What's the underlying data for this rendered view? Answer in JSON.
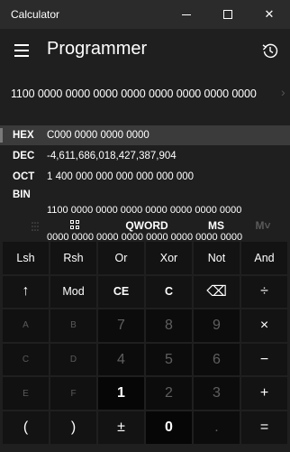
{
  "window": {
    "title": "Calculator",
    "minimize_icon": "minimize-icon",
    "maximize_icon": "maximize-icon",
    "close_icon": "close-icon",
    "close_glyph": "✕"
  },
  "header": {
    "menu_icon": "hamburger-menu-icon",
    "mode_title": "Programmer",
    "history_icon": "history-icon"
  },
  "display": {
    "binary_value": "1100 0000 0000 0000 0000 0000 0000 0000 0000",
    "chevron": "›"
  },
  "radix": {
    "hex": {
      "label": "HEX",
      "value": "C000 0000 0000 0000"
    },
    "dec": {
      "label": "DEC",
      "value": "-4,611,686,018,427,387,904"
    },
    "oct": {
      "label": "OCT",
      "value": "1 400 000 000 000 000 000 000"
    },
    "bin": {
      "label": "BIN",
      "value_line1": "1100 0000 0000 0000 0000 0000 0000 0000",
      "value_line2": "0000 0000 0000 0000 0000 0000 0000 0000"
    }
  },
  "toolbar": {
    "bit_toggle_icon": "bit-toggle-dots-icon",
    "keypad_icon": "full-keypad-icon",
    "word_size": "QWORD",
    "memory_store": "MS",
    "memory_recall": "M˅"
  },
  "keys": {
    "lsh": "Lsh",
    "rsh": "Rsh",
    "or": "Or",
    "xor": "Xor",
    "not": "Not",
    "and": "And",
    "up": "↑",
    "mod": "Mod",
    "ce": "CE",
    "c": "C",
    "backspace": "⌫",
    "divide": "÷",
    "a": "A",
    "b": "B",
    "seven": "7",
    "eight": "8",
    "nine": "9",
    "multiply": "×",
    "c_hex": "C",
    "d": "D",
    "four": "4",
    "five": "5",
    "six": "6",
    "minus": "−",
    "e": "E",
    "f": "F",
    "one": "1",
    "two": "2",
    "three": "3",
    "plus": "+",
    "lparen": "(",
    "rparen": ")",
    "negate": "±",
    "zero": "0",
    "decimal": ".",
    "equals": "="
  },
  "colors": {
    "background": "#1f1f1f",
    "operator_key": "#131313",
    "number_key": "#060606",
    "selected_row": "#3b3b3b"
  }
}
